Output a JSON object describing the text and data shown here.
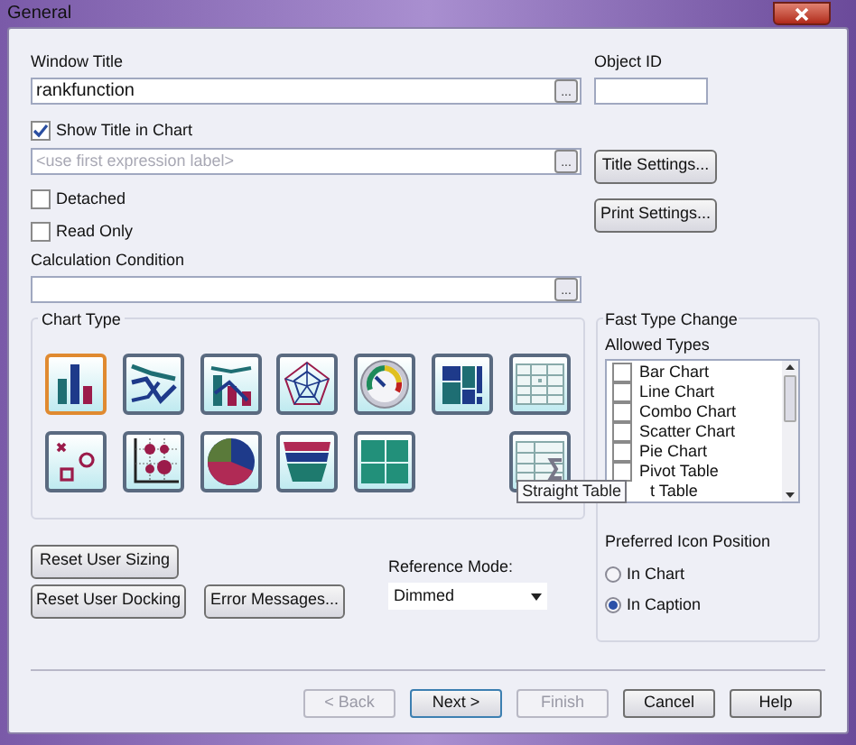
{
  "window": {
    "title": "General"
  },
  "window_title": {
    "label": "Window Title",
    "value": "rankfunction"
  },
  "object_id": {
    "label": "Object ID"
  },
  "show_title": {
    "label": "Show Title in Chart",
    "checked": true
  },
  "title_expression": {
    "placeholder": "<use first expression label>"
  },
  "title_settings_button": "Title Settings...",
  "print_settings_button": "Print Settings...",
  "options": [
    {
      "label": "Detached",
      "checked": false
    },
    {
      "label": "Read Only",
      "checked": false
    }
  ],
  "calculation_condition": {
    "label": "Calculation Condition"
  },
  "ellipsis": "...",
  "chart_type": {
    "title": "Chart Type",
    "types": [
      {
        "kind": "bar",
        "selected": true
      },
      {
        "kind": "line",
        "selected": false
      },
      {
        "kind": "combo",
        "selected": false
      },
      {
        "kind": "radar",
        "selected": false
      },
      {
        "kind": "gauge",
        "selected": false
      },
      {
        "kind": "mekko",
        "selected": false
      },
      {
        "kind": "pivot",
        "selected": false
      },
      {
        "kind": "scatter",
        "selected": false
      },
      {
        "kind": "grid",
        "selected": false
      },
      {
        "kind": "pie",
        "selected": false
      },
      {
        "kind": "funnel",
        "selected": false
      },
      {
        "kind": "block",
        "selected": false
      },
      {
        "kind": "straight",
        "selected": false
      }
    ]
  },
  "tooltip": "Straight Table",
  "fast_type_change": {
    "title": "Fast Type Change",
    "allowed_label": "Allowed Types",
    "items": [
      {
        "label": "Bar Chart",
        "checked": false
      },
      {
        "label": "Line Chart",
        "checked": false
      },
      {
        "label": "Combo Chart",
        "checked": false
      },
      {
        "label": "Scatter Chart",
        "checked": false
      },
      {
        "label": "Pie Chart",
        "checked": false
      },
      {
        "label": "Pivot Table",
        "checked": false
      },
      {
        "label": "t Table"
      }
    ]
  },
  "icon_position": {
    "label": "Preferred Icon Position",
    "options": [
      {
        "label": "In Chart",
        "selected": false
      },
      {
        "label": "In Caption",
        "selected": true
      }
    ]
  },
  "reset_buttons": [
    "Reset User Sizing",
    "Reset User Docking"
  ],
  "error_messages_button": "Error Messages...",
  "reference_mode": {
    "label": "Reference Mode:",
    "value": "Dimmed"
  },
  "wizard_buttons": [
    {
      "label": "< Back",
      "disabled": true
    },
    {
      "label": "Next >",
      "disabled": false
    },
    {
      "label": "Finish",
      "disabled": true
    },
    {
      "label": "Cancel",
      "disabled": false
    },
    {
      "label": "Help",
      "disabled": false
    }
  ]
}
